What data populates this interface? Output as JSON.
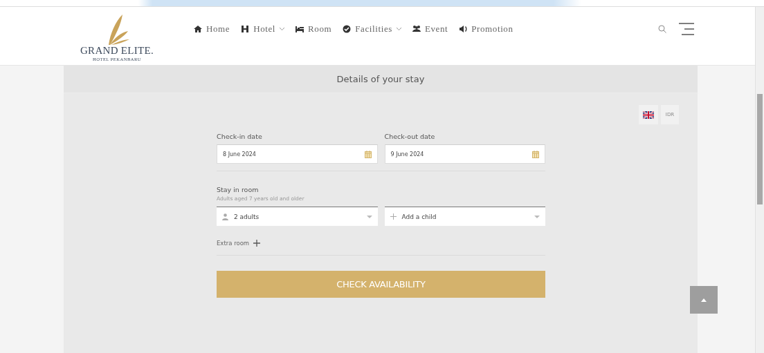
{
  "logo": {
    "name": "GRAND ELITE.",
    "subtitle": "HOTEL PEKANBARU"
  },
  "nav": [
    {
      "label": "Home",
      "dropdown": false
    },
    {
      "label": "Hotel",
      "dropdown": true
    },
    {
      "label": "Room",
      "dropdown": false
    },
    {
      "label": "Facilities",
      "dropdown": true
    },
    {
      "label": "Event",
      "dropdown": false
    },
    {
      "label": "Promotion",
      "dropdown": false
    }
  ],
  "booking": {
    "title": "Details of your stay",
    "currency": "IDR",
    "check_in": {
      "label": "Check-in date",
      "value": "8 June 2024"
    },
    "check_out": {
      "label": "Check-out date",
      "value": "9 June 2024"
    },
    "stay": {
      "label": "Stay in room",
      "hint": "Adults aged 7 years old and older"
    },
    "adults": {
      "value": "2 adults"
    },
    "children": {
      "value": "Add a child"
    },
    "extra_room": "Extra room",
    "submit": "CHECK AVAILABILITY"
  }
}
